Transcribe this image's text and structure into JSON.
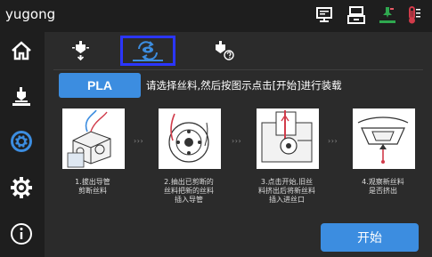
{
  "app": {
    "title": "yugong"
  },
  "top_icons": [
    "monitor-icon",
    "printer-icon",
    "nozzle-status-icon",
    "thermometer-icon"
  ],
  "sidebar": {
    "items": [
      "home-icon",
      "extruder-icon",
      "filament-icon",
      "settings-icon",
      "info-icon"
    ]
  },
  "tabs": [
    {
      "name": "extrude-tab",
      "active": false
    },
    {
      "name": "load-filament-tab",
      "active": true
    },
    {
      "name": "extrude-help-tab",
      "active": false
    }
  ],
  "material_button": {
    "label": "PLA"
  },
  "instruction": "请选择丝料,然后按图示点击[开始]进行装载",
  "steps": [
    {
      "caption": "1.拔出导管\n剪断丝料"
    },
    {
      "caption": "2.抽出已剪断的\n丝料把新的丝料\n插入导管"
    },
    {
      "caption": "3.点击开始,旧丝\n料挤出后将新丝料\n插入进丝口"
    },
    {
      "caption": "4.观察新丝料\n是否挤出"
    }
  ],
  "step_arrow": "› › ›",
  "start_button": {
    "label": "开始"
  },
  "colors": {
    "accent": "#3c8de0",
    "highlight_box": "#2b36ff",
    "background": "#2b2b2b",
    "panel": "#1e1e1e",
    "status_green": "#2fa84f",
    "status_red": "#d13b4a"
  }
}
